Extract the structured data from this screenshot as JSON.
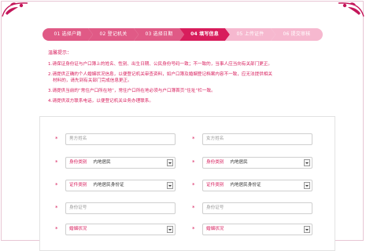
{
  "steps": [
    {
      "label": "01 选择户籍",
      "state": "done"
    },
    {
      "label": "02 登记机关",
      "state": "done"
    },
    {
      "label": "03 选择日期",
      "state": "done"
    },
    {
      "label": "04 填写信息",
      "state": "active"
    },
    {
      "label": "05 上传证件",
      "state": "future"
    },
    {
      "label": "06 提交审核",
      "state": "future"
    }
  ],
  "notice": {
    "title": "温馨提示：",
    "items": [
      {
        "text": "1.请保证身份证与户口簿上的姓名、性别、出生日期、公民身份号码一致；不一致的，当事人应当向有关部门更正。"
      },
      {
        "text": "2.请提供正确的个人婚姻状况信息，以便登记机关审查资料，如户口簿及婚姻登记档案内容不一致，应无法提供相关",
        "sub": "材料的，请先到有关部门完成信息更正。"
      },
      {
        "text": "3.请提供当前的“常住户口所在地”，常住户口所在地必须与户口簿首页“住址”栏一致。"
      },
      {
        "text": "4.请提供双方联系电话，以便登记机关业务办理联系。"
      }
    ]
  },
  "form": {
    "left": {
      "name_placeholder": "男方姓名",
      "id_type_label": "身份类别",
      "id_type_value": "内地居民",
      "cert_type_label": "证件类别",
      "cert_type_value": "内地居民身份证",
      "cert_no_placeholder": "身份证号",
      "marital_label": "婚姻状况"
    },
    "right": {
      "name_placeholder": "女方姓名",
      "id_type_label": "身份类别",
      "id_type_value": "内地居民",
      "cert_type_label": "证件类别",
      "cert_type_value": "内地居民身份证",
      "cert_no_placeholder": "身份证号",
      "marital_label": "婚姻状况"
    },
    "required_mark": "*"
  },
  "colors": {
    "accent": "#d81d5c",
    "step_done": "#e05a86",
    "step_future": "#f6b8cf"
  }
}
